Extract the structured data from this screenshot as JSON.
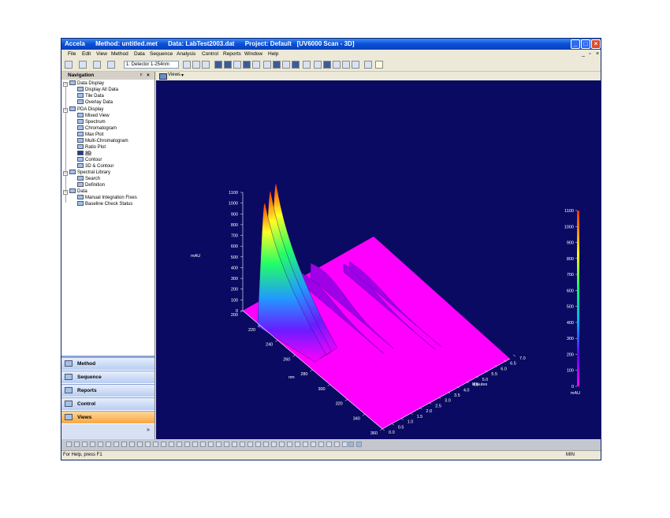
{
  "window": {
    "title": "Accela      Method: untitled.met      Data: LabTest2003.dat      Project: Default   [UV6000 Scan - 3D]"
  },
  "menu": [
    "File",
    "Edit",
    "View",
    "Method",
    "Data",
    "Sequence",
    "Analysis",
    "Control",
    "Reports",
    "Window",
    "Help"
  ],
  "toolbar": {
    "detector": "1: Detector 1-254nm"
  },
  "navigation": {
    "title": "Navigation",
    "groups": [
      {
        "label": "Data Display",
        "items": [
          "Display All Data",
          "Tile Data",
          "Overlay Data"
        ]
      },
      {
        "label": "PDA Display",
        "items": [
          "Mixed View",
          "Spectrum",
          "Chromatogram",
          "Max Plot",
          "Multi-Chromatogram",
          "Ratio Plot",
          "3D",
          "Contour",
          "3D & Contour"
        ]
      },
      {
        "label": "Spectral Library",
        "items": [
          "Search",
          "Definition"
        ]
      },
      {
        "label": "Data",
        "items": [
          "Manual Integration Fixes",
          "Baseline Check Status"
        ]
      }
    ],
    "selected": "3D",
    "sections": [
      "Method",
      "Sequence",
      "Reports",
      "Control",
      "Views"
    ],
    "active_section": "Views"
  },
  "views_tab": "Views",
  "statusbar": {
    "help": "For Help, press F1",
    "mode": "MIN"
  },
  "chart_data": {
    "type": "area",
    "surface": "3d-wireframe-surface",
    "zlabel": "mAU",
    "z_ticks": [
      0,
      100,
      200,
      300,
      400,
      500,
      600,
      700,
      800,
      900,
      1000,
      1100
    ],
    "ylabel": "nm",
    "y_ticks": [
      200,
      220,
      240,
      260,
      280,
      300,
      320,
      340,
      360
    ],
    "xlabel": "Minutes",
    "x_ticks": [
      "0.0",
      "0.5",
      "1.0",
      "1.5",
      "2.0",
      "2.5",
      "3.0",
      "3.5",
      "4.0",
      "4.5",
      "5.0",
      "5.5",
      "6.0",
      "6.5",
      "7.0"
    ],
    "colorbar": {
      "label": "mAU",
      "ticks": [
        0,
        100,
        200,
        300,
        400,
        500,
        600,
        700,
        800,
        900,
        1000,
        1100
      ]
    },
    "series": [
      {
        "x": [
          0.7,
          1.0,
          1.3,
          2.9,
          3.4,
          4.7,
          5.0
        ],
        "values": [
          1000,
          1080,
          1120,
          130,
          180,
          100,
          90
        ]
      }
    ],
    "colors": {
      "background": "#0a0a62",
      "floor": "#ff00ff"
    }
  }
}
